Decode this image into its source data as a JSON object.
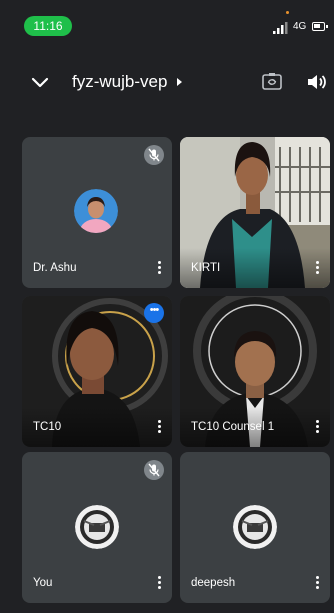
{
  "status": {
    "time": "11:16",
    "network": "4G"
  },
  "header": {
    "meeting_code": "fyz-wujb-vep"
  },
  "participants": [
    {
      "name": "Dr. Ashu",
      "muted": true,
      "video": false
    },
    {
      "name": "KIRTI",
      "muted": false,
      "video": true
    },
    {
      "name": "TC10",
      "muted": false,
      "video": true,
      "more_badge": "•••"
    },
    {
      "name": "TC10 Counsel 1",
      "muted": false,
      "video": true
    },
    {
      "name": "You",
      "muted": true,
      "video": false
    },
    {
      "name": "deepesh",
      "muted": false,
      "video": false
    }
  ],
  "colors": {
    "background": "#202124",
    "tile": "#3c4043",
    "time_pill": "#1fbf4a",
    "accent": "#1a73e8"
  },
  "icons": [
    "chevron-down-icon",
    "camera-switch-icon",
    "speaker-icon",
    "mic-off-icon",
    "more-vert-icon"
  ]
}
